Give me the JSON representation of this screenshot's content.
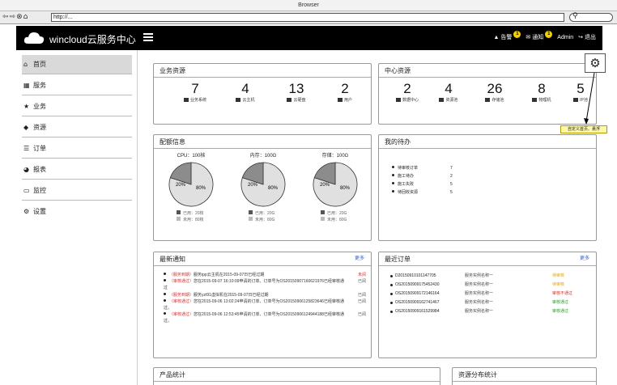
{
  "browser": {
    "title": "Browser",
    "url": "http://...",
    "nav_icons": "⇦⇨⊗⌂"
  },
  "header": {
    "brand": "wincloud云服务中心",
    "alert_label": "告警",
    "alert_count": "1",
    "notice_label": "通知",
    "notice_count": "1",
    "user": "Admin",
    "logout": "退出"
  },
  "sidebar": {
    "items": [
      {
        "label": "首页",
        "icon": "home-icon",
        "glyph": "⌂"
      },
      {
        "label": "服务",
        "icon": "grid-icon",
        "glyph": "▦"
      },
      {
        "label": "业务",
        "icon": "star-icon",
        "glyph": "★"
      },
      {
        "label": "资源",
        "icon": "cube-icon",
        "glyph": "◆"
      },
      {
        "label": "订单",
        "icon": "list-icon",
        "glyph": "☰"
      },
      {
        "label": "报表",
        "icon": "pie-icon",
        "glyph": "◕"
      },
      {
        "label": "监控",
        "icon": "monitor-icon",
        "glyph": "▭"
      },
      {
        "label": "设置",
        "icon": "gear-icon",
        "glyph": "⚙"
      }
    ]
  },
  "business": {
    "title": "业务资源",
    "stats": [
      {
        "value": "7",
        "label": "业务系统"
      },
      {
        "value": "4",
        "label": "云主机"
      },
      {
        "value": "13",
        "label": "云硬盘"
      },
      {
        "value": "2",
        "label": "用户"
      }
    ]
  },
  "center": {
    "title": "中心资源",
    "stats": [
      {
        "value": "2",
        "label": "数据中心"
      },
      {
        "value": "4",
        "label": "资源池"
      },
      {
        "value": "26",
        "label": "存储池"
      },
      {
        "value": "8",
        "label": "物理机"
      },
      {
        "value": "5",
        "label": "IP池"
      }
    ]
  },
  "customize_tip": "自定义首页、悬浮",
  "quota": {
    "title": "配额信息",
    "items": [
      {
        "title": "CPU：100核",
        "used_label": "已用：20核",
        "free_label": "未用：80核",
        "used_pct": "20%",
        "free_pct": "80%",
        "used_fraction": 0.2
      },
      {
        "title": "内存：100G",
        "used_label": "已用：20G",
        "free_label": "未用：80G",
        "used_pct": "20%",
        "free_pct": "80%",
        "used_fraction": 0.2
      },
      {
        "title": "存储：100G",
        "used_label": "已用：20G",
        "free_label": "未用：80G",
        "used_pct": "20%",
        "free_pct": "80%",
        "used_fraction": 0.2
      }
    ],
    "used_color": "#8c8c8c",
    "free_color": "#e0e0e0"
  },
  "todo": {
    "title": "我的待办",
    "items": [
      {
        "label": "待审核订单",
        "value": "7"
      },
      {
        "label": "施工待办",
        "value": "2"
      },
      {
        "label": "施工失败",
        "value": "5"
      },
      {
        "label": "待回收资源",
        "value": "5"
      }
    ]
  },
  "notices": {
    "title": "最新通知",
    "more": "更多",
    "items": [
      {
        "tag": "（服务到期）",
        "text": "服务ipp云主机在2015-09-07日已经过期",
        "status": "未阅",
        "red": true
      },
      {
        "tag": "（审核通过）",
        "text": "您在2015-09-07 16:10:09申请的订单、订单号为OS20150907160621976已经审核通过",
        "status": "已阅",
        "red": false
      },
      {
        "tag": "（服务到期）",
        "text": "服务yzt91虚拟机在2015-09-07日已经过期",
        "status": "已阅",
        "red": false
      },
      {
        "tag": "（审核通过）",
        "text": "您在2015-09-06 13:02:24申请的订单、订单号为OS20150906125823646已经审核通过。",
        "status": "已阅",
        "red": false
      },
      {
        "tag": "（审核通过）",
        "text": "您在2015-09-06 12:53:45申请的订单、订单号为OS20150906124944188已经审核通过。",
        "status": "已阅",
        "red": false
      }
    ]
  },
  "orders": {
    "title": "最近订单",
    "more": "更多",
    "items": [
      {
        "id": "D20150910101147705",
        "name": "服务实例名称一",
        "status": "待审核",
        "color": "#e8a400"
      },
      {
        "id": "OS20150909175452430",
        "name": "服务实例名称一",
        "status": "待审核",
        "color": "#e8a400"
      },
      {
        "id": "OS20150909172146164",
        "name": "服务实例名称一",
        "status": "审核不通过",
        "color": "#d03030"
      },
      {
        "id": "OS20150909162741467",
        "name": "服务实例名称一",
        "status": "审核通过",
        "color": "#2a9a2a"
      },
      {
        "id": "OS20150909161529984",
        "name": "服务实例名称一",
        "status": "审核通过",
        "color": "#2a9a2a"
      }
    ]
  },
  "product_stats": {
    "title": "产品统计"
  },
  "resource_stats": {
    "title": "资源分布统计"
  }
}
